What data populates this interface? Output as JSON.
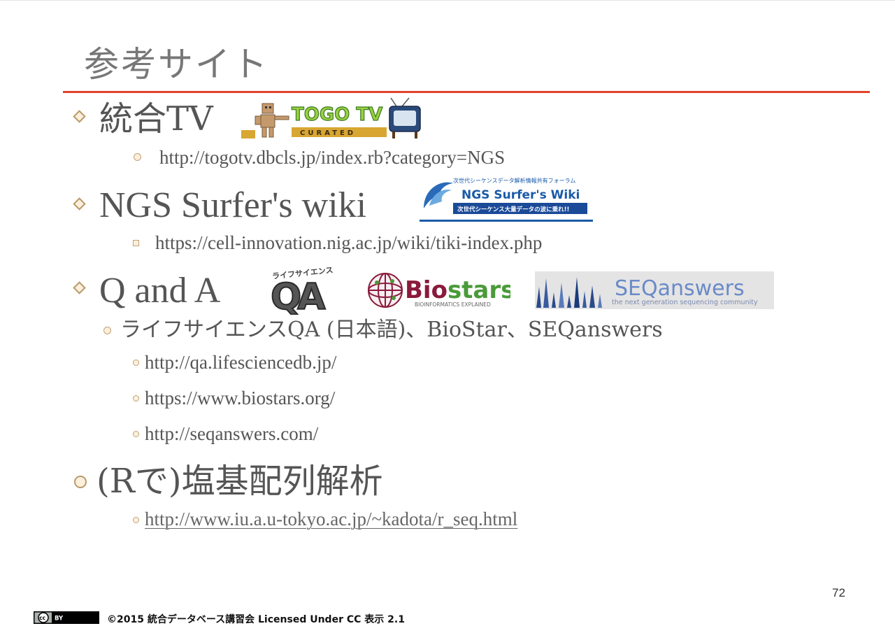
{
  "slide": {
    "title": "参考サイト",
    "page_number": "72"
  },
  "sections": {
    "togotv": {
      "heading": "統合TV",
      "url": "http://togotv.dbcls.jp/index.rb?category=NGS",
      "logo": {
        "name": "TOGO TV",
        "subtitle": "CURATED"
      }
    },
    "ngs_wiki": {
      "heading": "NGS Surfer's wiki",
      "url": "https://cell-innovation.nig.ac.jp/wiki/tiki-index.php",
      "logo": {
        "top_text": "次世代シーケンスデータ解析情報共有フォーラム",
        "name": "NGS Surfer's Wiki",
        "tagline": "次世代シーケンス大量データの波に乗れ!!"
      }
    },
    "qa": {
      "heading": "Q and A",
      "sub": "ライフサイエンスQA (日本語)、BioStar、SEQanswers",
      "links": [
        "http://qa.lifesciencedb.jp/",
        "https://www.biostars.org/",
        "http://seqanswers.com/"
      ],
      "logos": {
        "lsqa": {
          "name": "QA",
          "top_text": "ライフサイエンス"
        },
        "biostars": {
          "name_prefix": "Bio",
          "name_suffix": "stars",
          "tagline": "BIOINFORMATICS EXPLAINED"
        },
        "seqanswers": {
          "name": "SEQanswers",
          "tagline": "the next generation sequencing community"
        }
      }
    },
    "r_seq": {
      "heading": "(Rで)塩基配列解析",
      "url": "http://www.iu.a.u-tokyo.ac.jp/~kadota/r_seq.html"
    }
  },
  "footer": {
    "license_badge": {
      "left": "cc",
      "right": "BY"
    },
    "text": "©2015 統合データベース講習会 Licensed Under CC 表示 2.1"
  },
  "colors": {
    "title_rule": "#e2432a",
    "bullet_border": "#b99a6a",
    "bullet_fill": "#fcf0dc",
    "togo_green": "#55b030",
    "ngs_blue": "#1a5aa8",
    "biostars_maroon": "#8a1a3a",
    "biostars_green": "#4a9a3a",
    "seqanswers_blue": "#5a7ab8"
  }
}
